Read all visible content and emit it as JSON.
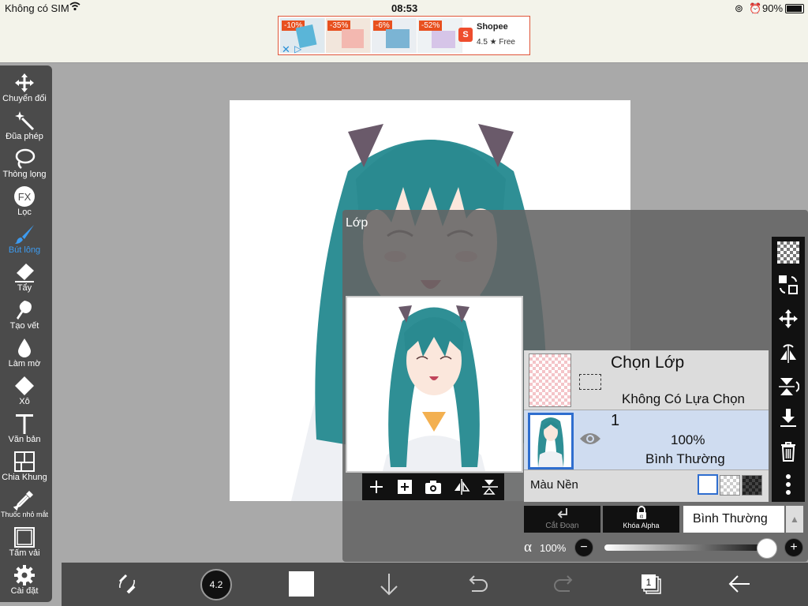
{
  "status": {
    "carrier": "Không có SIM",
    "time": "08:53",
    "battery": "90%"
  },
  "ad": {
    "discounts": [
      "-10%",
      "-35%",
      "-6%",
      "-52%"
    ],
    "brand": "Shopee",
    "rating": "4.5 ★ Free"
  },
  "tools": [
    {
      "label": "Chuyển đổi",
      "icon": "move-icon"
    },
    {
      "label": "Đũa phép",
      "icon": "magic-wand-icon"
    },
    {
      "label": "Thòng lọng",
      "icon": "lasso-icon"
    },
    {
      "label": "Lọc",
      "icon": "fx-icon"
    },
    {
      "label": "Bút lông",
      "icon": "brush-icon",
      "active": true
    },
    {
      "label": "Tẩy",
      "icon": "eraser-icon"
    },
    {
      "label": "Tạo vết",
      "icon": "smudge-icon"
    },
    {
      "label": "Làm mờ",
      "icon": "blur-icon"
    },
    {
      "label": "Xô",
      "icon": "bucket-icon"
    },
    {
      "label": "Văn bản",
      "icon": "text-icon"
    },
    {
      "label": "Chia Khung",
      "icon": "frame-divider-icon"
    },
    {
      "label": "Thuốc nhỏ mắt",
      "icon": "eyedropper-icon"
    },
    {
      "label": "Tấm vải",
      "icon": "canvas-icon"
    },
    {
      "label": "Cài đặt",
      "icon": "gear-icon"
    }
  ],
  "layers_panel": {
    "title": "Lớp",
    "selection_layer": {
      "title": "Chọn Lớp",
      "status": "Không Có Lựa Chọn"
    },
    "layer1": {
      "name": "1",
      "opacity": "100%",
      "blend": "Bình Thường"
    },
    "background": {
      "label": "Màu Nền"
    },
    "clipping_label": "Cắt Đoạn",
    "alpha_lock_label": "Khóa Alpha",
    "blend_mode": "Bình Thường",
    "alpha_symbol": "α",
    "opacity_value": "100%",
    "opacity_fraction": 1.0
  },
  "bottom": {
    "brush_size": "4.2",
    "layer_count": "1"
  },
  "colors": {
    "accent": "#3d9bf0",
    "toolbar": "#4b4b4b",
    "selected_layer": "#cfdcf0"
  }
}
